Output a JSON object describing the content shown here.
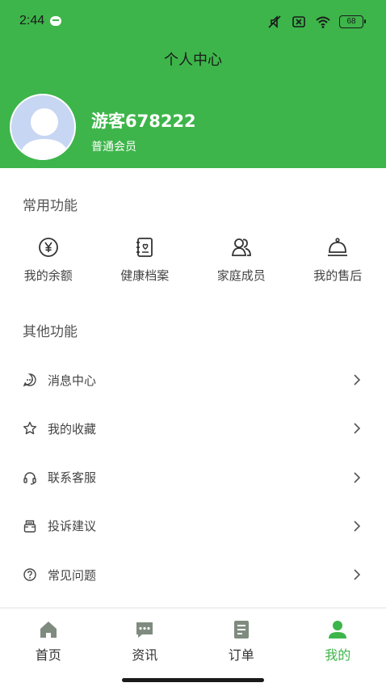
{
  "status_bar": {
    "time": "2:44",
    "battery": "68"
  },
  "header": {
    "title": "个人中心",
    "user_name": "游客678222",
    "member_level": "普通会员"
  },
  "common_features": {
    "title": "常用功能",
    "items": [
      {
        "label": "我的余额",
        "icon": "yen-icon"
      },
      {
        "label": "健康档案",
        "icon": "health-record-icon"
      },
      {
        "label": "家庭成员",
        "icon": "family-members-icon"
      },
      {
        "label": "我的售后",
        "icon": "service-bell-icon"
      }
    ]
  },
  "other_features": {
    "title": "其他功能",
    "items": [
      {
        "label": "消息中心",
        "icon": "message-icon"
      },
      {
        "label": "我的收藏",
        "icon": "star-icon"
      },
      {
        "label": "联系客服",
        "icon": "headset-icon"
      },
      {
        "label": "投诉建议",
        "icon": "complaint-icon"
      },
      {
        "label": "常见问题",
        "icon": "question-icon"
      }
    ]
  },
  "tab_bar": {
    "items": [
      {
        "label": "首页",
        "icon": "home-icon"
      },
      {
        "label": "资讯",
        "icon": "news-icon"
      },
      {
        "label": "订单",
        "icon": "order-icon"
      },
      {
        "label": "我的",
        "icon": "profile-icon"
      }
    ],
    "active": "我的"
  },
  "colors": {
    "brand": "#3db54a",
    "inactive_icon": "#7f8b7f",
    "text": "#444444"
  }
}
